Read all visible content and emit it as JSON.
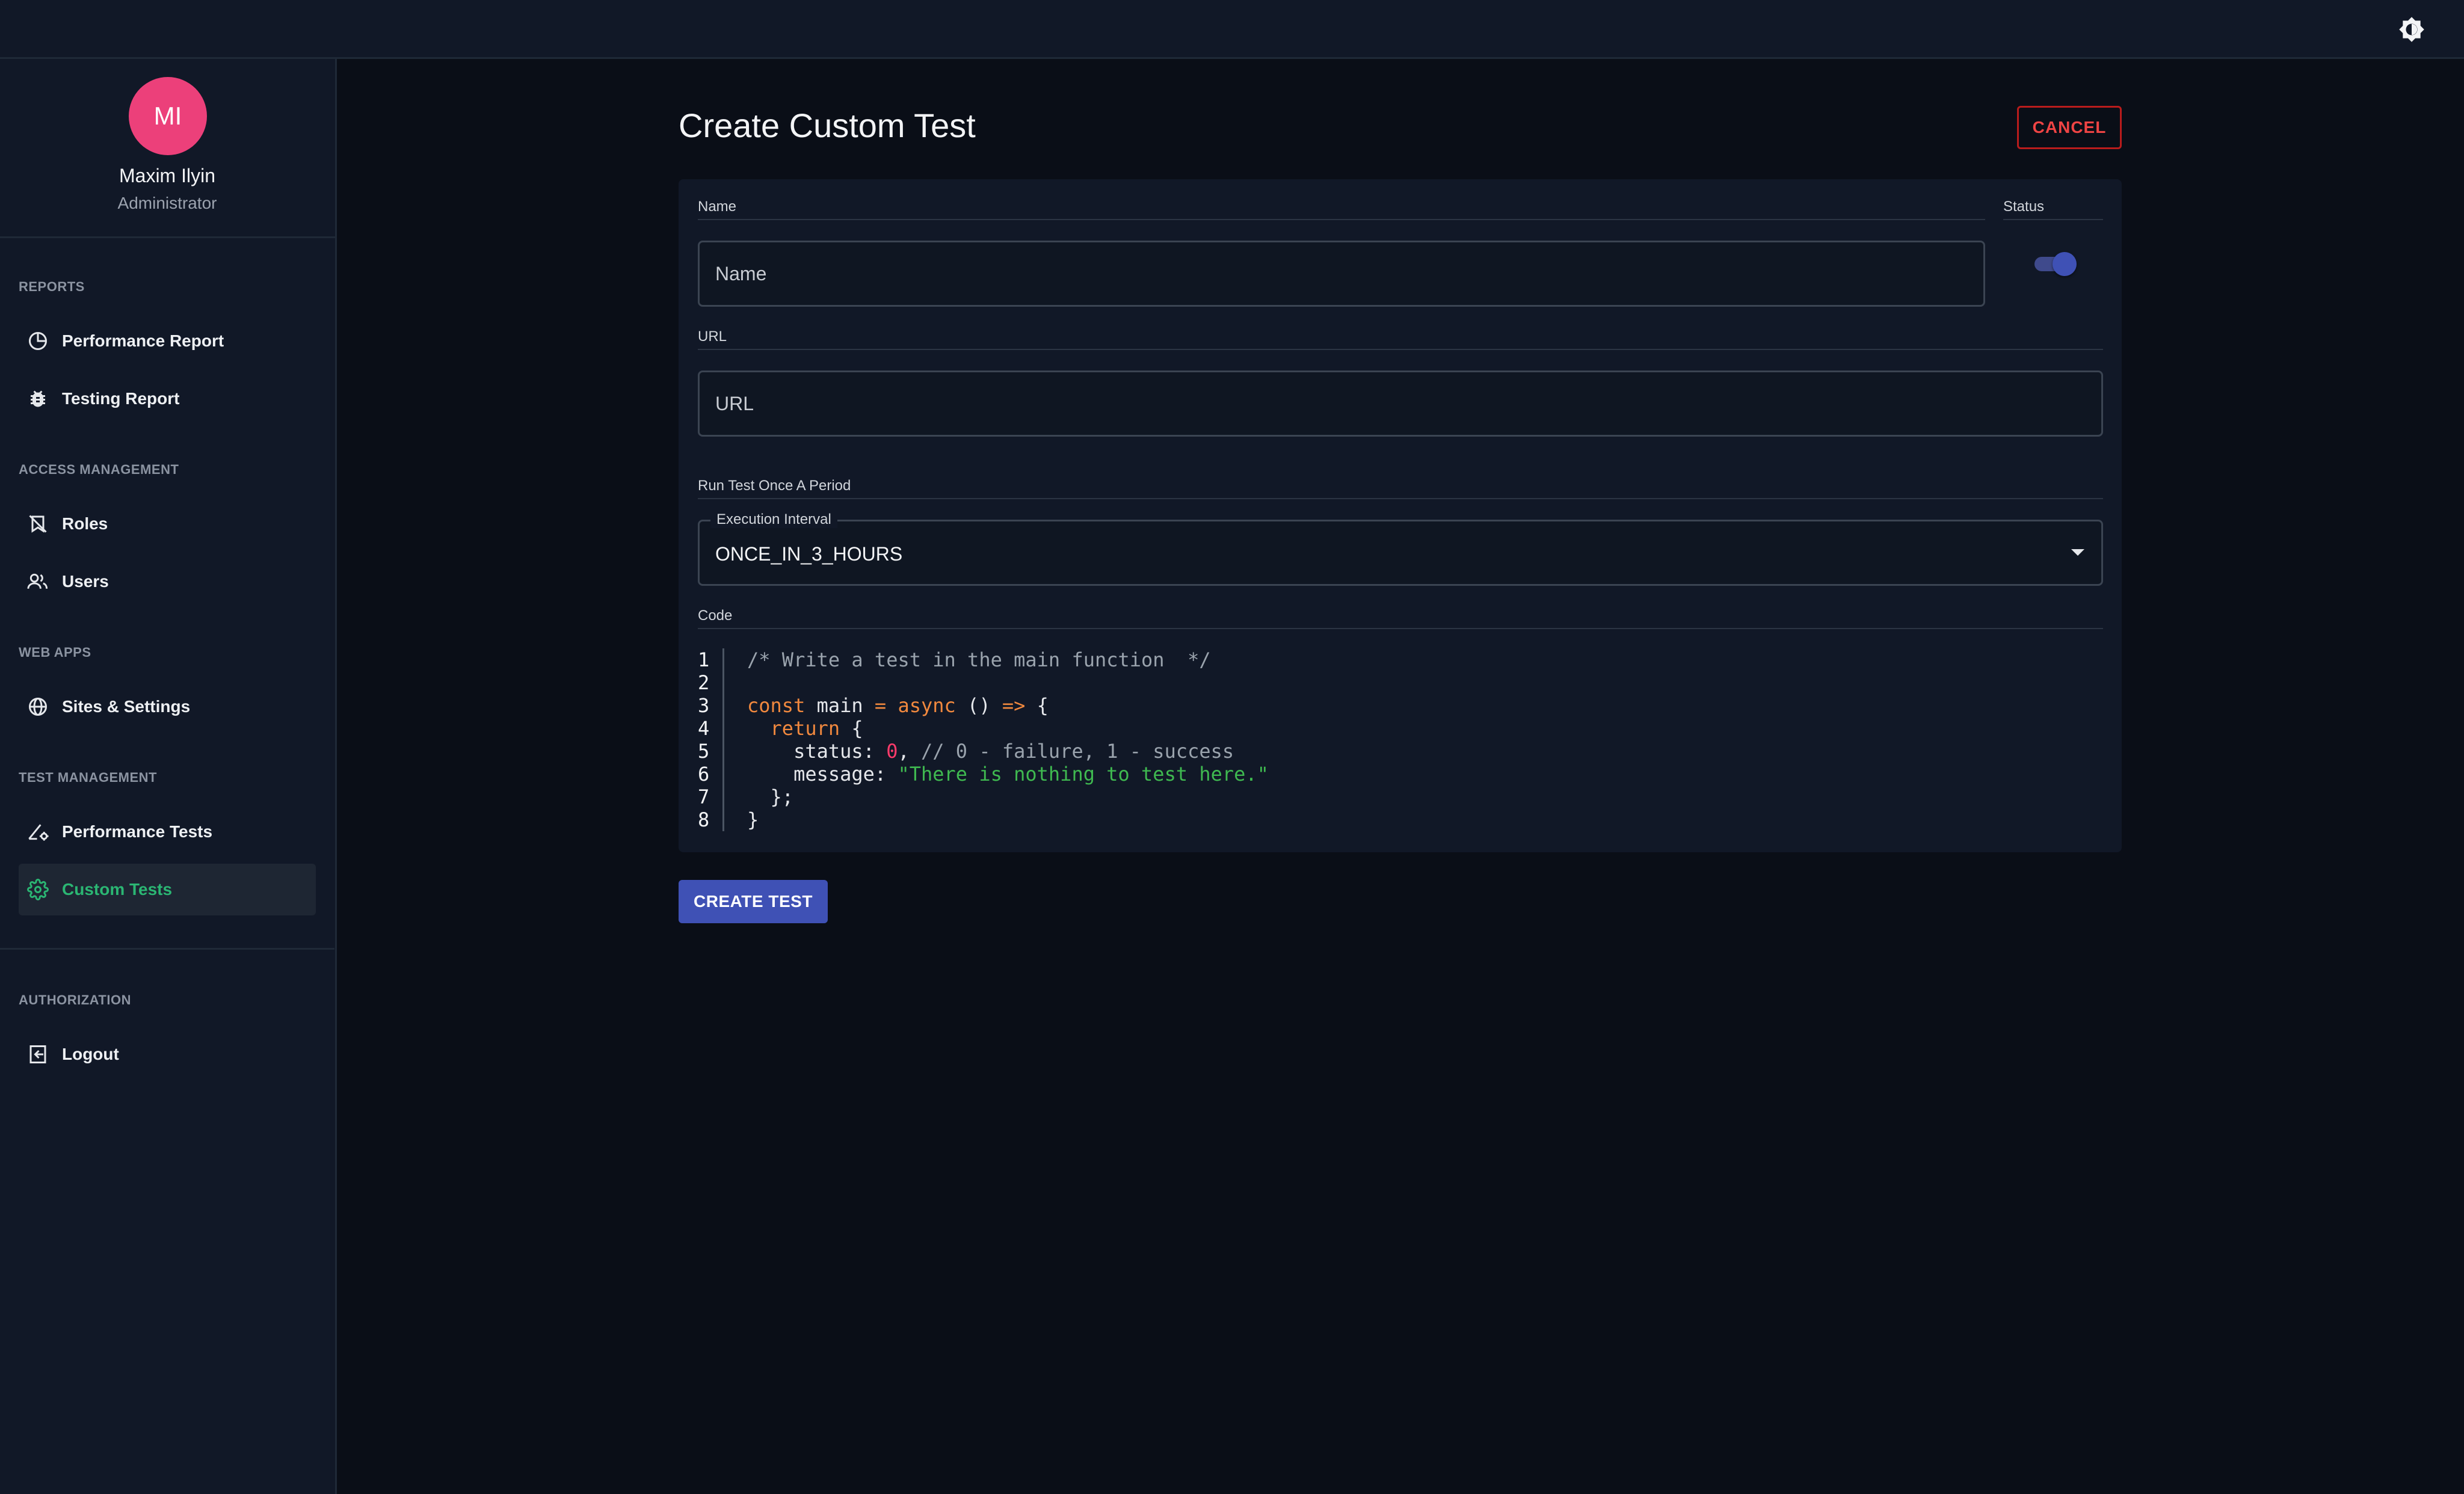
{
  "header": {
    "theme_toggle_icon": "brightness-icon"
  },
  "profile": {
    "initials": "MI",
    "name": "Maxim Ilyin",
    "role": "Administrator",
    "avatar_color": "#ec407a"
  },
  "sidebar": {
    "sections": [
      {
        "label": "REPORTS",
        "items": [
          {
            "label": "Performance Report",
            "icon": "pie-chart-icon"
          },
          {
            "label": "Testing Report",
            "icon": "bug-icon"
          }
        ]
      },
      {
        "label": "ACCESS MANAGEMENT",
        "items": [
          {
            "label": "Roles",
            "icon": "badge-off-icon"
          },
          {
            "label": "Users",
            "icon": "users-icon"
          }
        ]
      },
      {
        "label": "WEB APPS",
        "items": [
          {
            "label": "Sites & Settings",
            "icon": "globe-icon"
          }
        ]
      },
      {
        "label": "TEST MANAGEMENT",
        "items": [
          {
            "label": "Performance Tests",
            "icon": "speed-gear-icon"
          },
          {
            "label": "Custom Tests",
            "icon": "gear-icon",
            "active": true
          }
        ]
      },
      {
        "label": "AUTHORIZATION",
        "items": [
          {
            "label": "Logout",
            "icon": "logout-icon"
          }
        ]
      }
    ],
    "active_color": "#2bb673"
  },
  "main": {
    "title": "Create Custom Test",
    "cancel_label": "CANCEL",
    "create_label": "CREATE TEST",
    "form": {
      "name_label": "Name",
      "name_placeholder": "Name",
      "name_value": "",
      "status_label": "Status",
      "status_on": true,
      "url_label": "URL",
      "url_placeholder": "URL",
      "url_value": "",
      "period_label": "Run Test Once A Period",
      "interval_legend": "Execution Interval",
      "interval_value": "ONCE_IN_3_HOURS",
      "code_label": "Code",
      "code_line_numbers": [
        "1",
        "2",
        "3",
        "4",
        "5",
        "6",
        "7",
        "8"
      ],
      "code_lines": [
        "/* Write a test in the main function  */",
        "",
        "const main = async () => {",
        "  return {",
        "    status: 0, // 0 - failure, 1 - success",
        "    message: \"There is nothing to test here.\"",
        "  };",
        "}"
      ]
    }
  },
  "colors": {
    "background": "#0a0e17",
    "surface": "#111827",
    "primary": "#3f51b5",
    "danger": "#ef4444"
  }
}
